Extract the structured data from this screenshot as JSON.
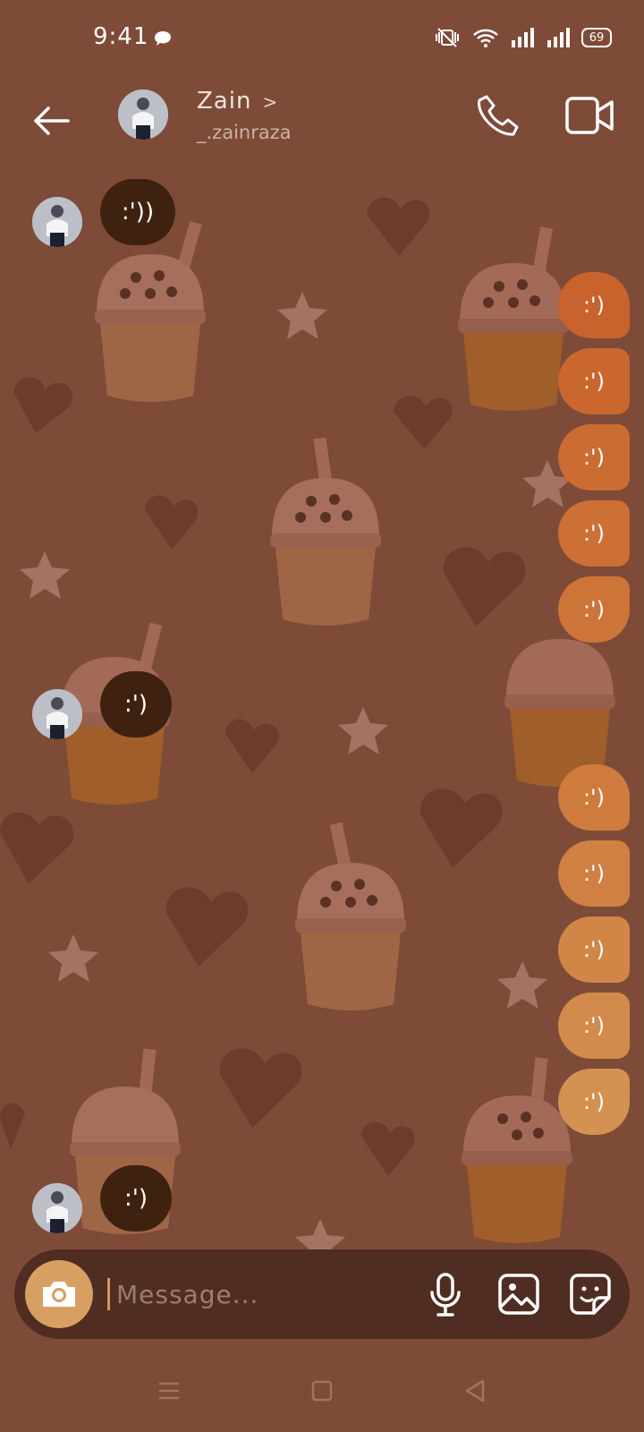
{
  "status_bar": {
    "time": "9:41",
    "battery": "69",
    "icons": [
      "chat-bubble-icon",
      "mute-vibrate-icon",
      "wifi-icon",
      "signal-icon",
      "signal-icon",
      "battery-icon"
    ]
  },
  "header": {
    "name": "Zain",
    "chevron": ">",
    "username": "_.zainraza",
    "icons": [
      "back-arrow-icon",
      "phone-icon",
      "video-camera-icon"
    ]
  },
  "messages": {
    "incoming": [
      {
        "text": ":'))"
      },
      {
        "text": ":')"
      },
      {
        "text": ":')"
      }
    ],
    "outgoing": [
      {
        "text": ":')",
        "color": "#c8632d"
      },
      {
        "text": ":')",
        "color": "#c9672f"
      },
      {
        "text": ":')",
        "color": "#cb6c33"
      },
      {
        "text": ":')",
        "color": "#cc7036"
      },
      {
        "text": ":')",
        "color": "#cd7439"
      },
      {
        "text": ":')",
        "color": "#cf7b3e"
      },
      {
        "text": ":')",
        "color": "#d08043"
      },
      {
        "text": ":')",
        "color": "#d18648"
      },
      {
        "text": ":')",
        "color": "#d28b4d"
      },
      {
        "text": ":')",
        "color": "#d39152"
      }
    ]
  },
  "composer": {
    "placeholder": "Message...",
    "icons": [
      "camera-icon",
      "microphone-icon",
      "gallery-icon",
      "sticker-icon"
    ]
  },
  "colors": {
    "background": "#7e4b38",
    "incoming_bubble": "#3f2110",
    "composer": "#4f2d22",
    "camera_button": "#d89f62"
  },
  "nav_bar": {
    "icons": [
      "menu-icon",
      "home-icon",
      "back-icon"
    ]
  }
}
